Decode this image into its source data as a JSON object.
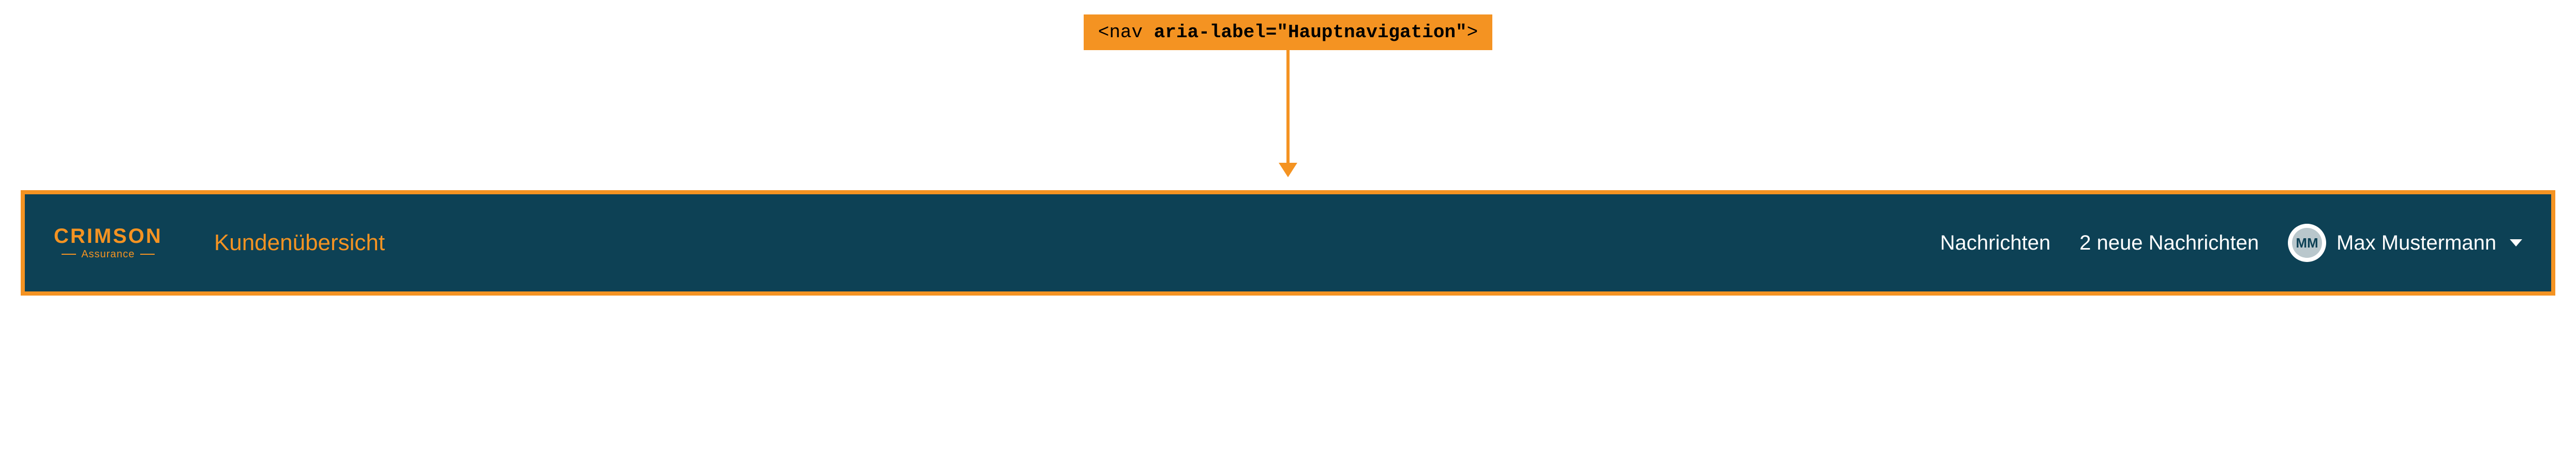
{
  "annotation": {
    "prefix": "<nav ",
    "attr": "aria-label=\"Hauptnavigation\"",
    "suffix": ">"
  },
  "logo": {
    "main": "CRIMSON",
    "sub": "Assurance"
  },
  "nav": {
    "title": "Kundenübersicht",
    "messages_label": "Nachrichten",
    "messages_status": "2 neue Nachrichten"
  },
  "user": {
    "initials": "MM",
    "name": "Max Mustermann"
  },
  "colors": {
    "accent": "#f49322",
    "navbar_bg": "#0d4155",
    "text_light": "#ffffff",
    "avatar_inner": "#b9c7cc"
  }
}
